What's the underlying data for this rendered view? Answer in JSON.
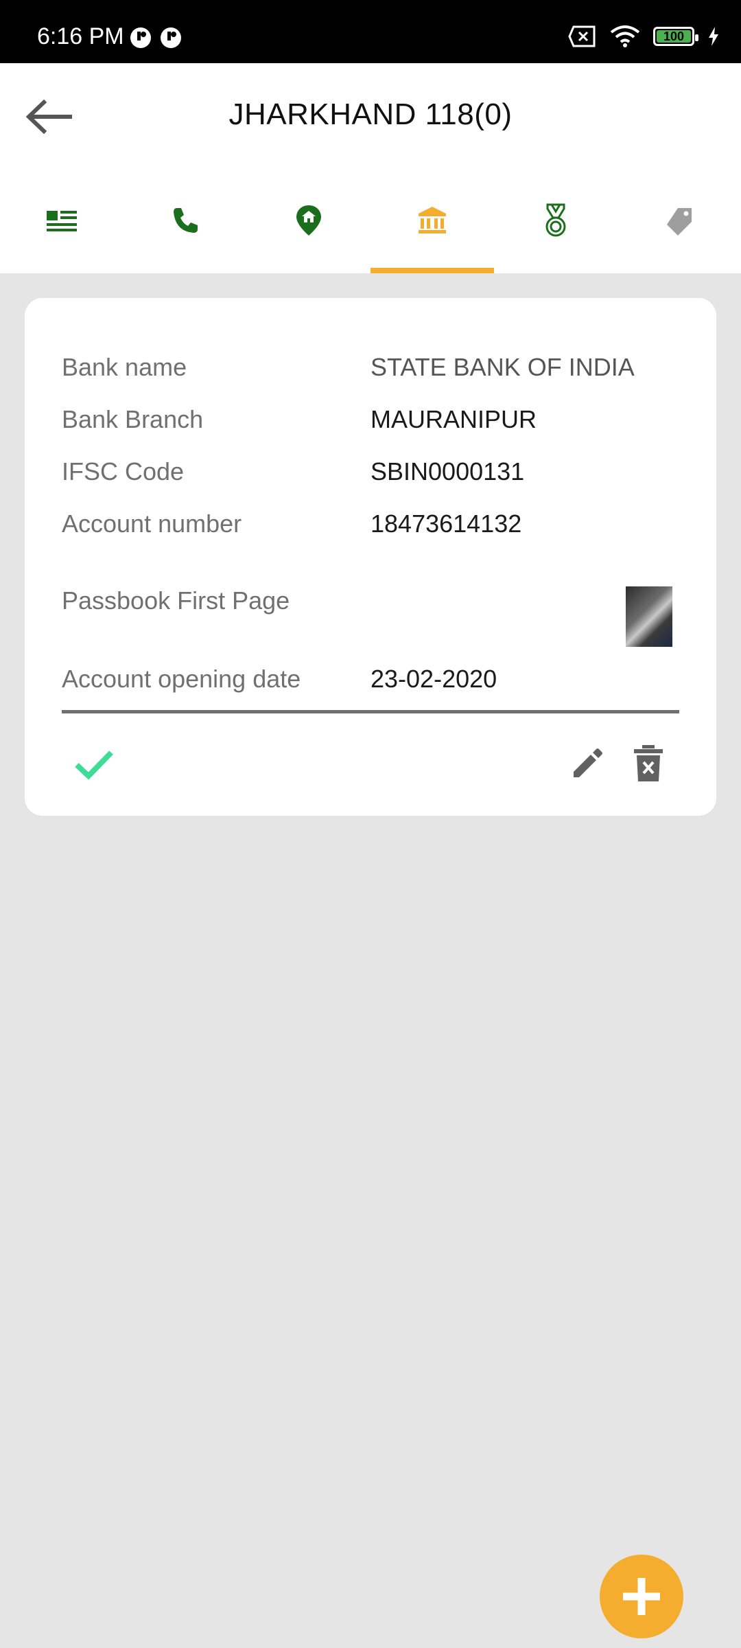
{
  "status_bar": {
    "time": "6:16 PM",
    "battery_level": "100",
    "icons": [
      "notification-icon",
      "notification-icon",
      "no-sim-icon",
      "wifi-icon",
      "battery-icon",
      "charging-icon"
    ]
  },
  "header": {
    "title": "JHARKHAND 118(0)",
    "back_icon": "arrow-left-icon"
  },
  "tabs": [
    {
      "icon": "list-icon",
      "active": false
    },
    {
      "icon": "phone-icon",
      "active": false
    },
    {
      "icon": "home-location-icon",
      "active": false
    },
    {
      "icon": "bank-icon",
      "active": true
    },
    {
      "icon": "medal-icon",
      "active": false
    },
    {
      "icon": "tag-icon",
      "active": false
    }
  ],
  "bank_details": {
    "bank_name_label": "Bank name",
    "bank_name_value": "STATE BANK OF INDIA",
    "branch_label": "Bank Branch",
    "branch_value": "MAURANIPUR",
    "ifsc_label": "IFSC Code",
    "ifsc_value": "SBIN0000131",
    "account_label": "Account number",
    "account_value": "18473614132",
    "passbook_label": "Passbook First Page",
    "opening_date_label": "Account opening date",
    "opening_date_value": "23-02-2020"
  },
  "colors": {
    "accent": "#f5ad2f",
    "tab_green": "#1b6e1b",
    "check_green": "#3ddc97",
    "icon_gray": "#616161"
  }
}
